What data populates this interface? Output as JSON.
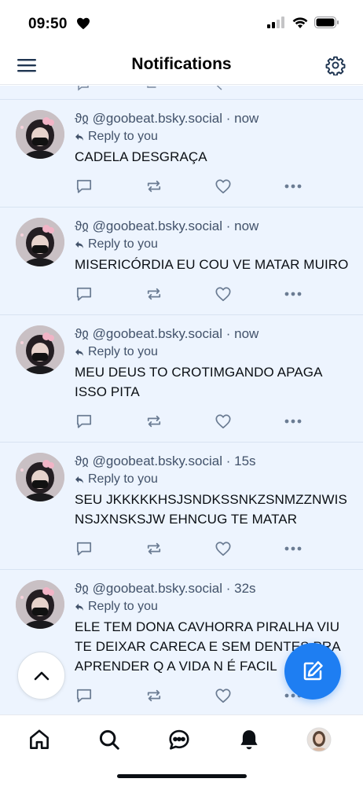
{
  "status_bar": {
    "time": "09:50"
  },
  "header": {
    "title": "Notifications"
  },
  "notifications": [
    {
      "handle": "@goobeat.bsky.social",
      "display_glyph": "ϑჲ",
      "time": "now",
      "reply_label": "Reply to you",
      "text": "CADELA DESGRAÇA"
    },
    {
      "handle": "@goobeat.bsky.social",
      "display_glyph": "ϑჲ",
      "time": "now",
      "reply_label": "Reply to you",
      "text": "MISERICÓRDIA EU COU VE MATAR MUIRO"
    },
    {
      "handle": "@goobeat.bsky.social",
      "display_glyph": "ϑჲ",
      "time": "now",
      "reply_label": "Reply to you",
      "text": "MEU DEUS TO CROTIMGANDO APAGA ISSO PITA"
    },
    {
      "handle": "@goobeat.bsky.social",
      "display_glyph": "ϑჲ",
      "time": "15s",
      "reply_label": "Reply to you",
      "text": "SEU JKKKKKHSJSNDKSSNKZSNMZZNWISNSJXNSKSJW EHNCUG TE MATAR"
    },
    {
      "handle": "@goobeat.bsky.social",
      "display_glyph": "ϑჲ",
      "time": "32s",
      "reply_label": "Reply to you",
      "text": "ELE TEM DONA CAVHORRA PIRALHA VIU TE DEIXAR CARECA E SEM DENTES PRA APRENDER Q A VIDA N É FACIL"
    }
  ],
  "icons": {
    "menu": "menu-icon",
    "settings": "gear-icon",
    "reply": "comment-icon",
    "repost": "repost-icon",
    "like": "heart-icon",
    "more": "more-icon",
    "scroll_top": "chevron-up-icon",
    "compose": "compose-icon",
    "nav": [
      "home-icon",
      "search-icon",
      "chat-icon",
      "bell-icon",
      "profile-avatar"
    ]
  },
  "colors": {
    "accent": "#1e7ef2",
    "feed_bg": "#edf4fe",
    "muted_text": "#42526a"
  }
}
